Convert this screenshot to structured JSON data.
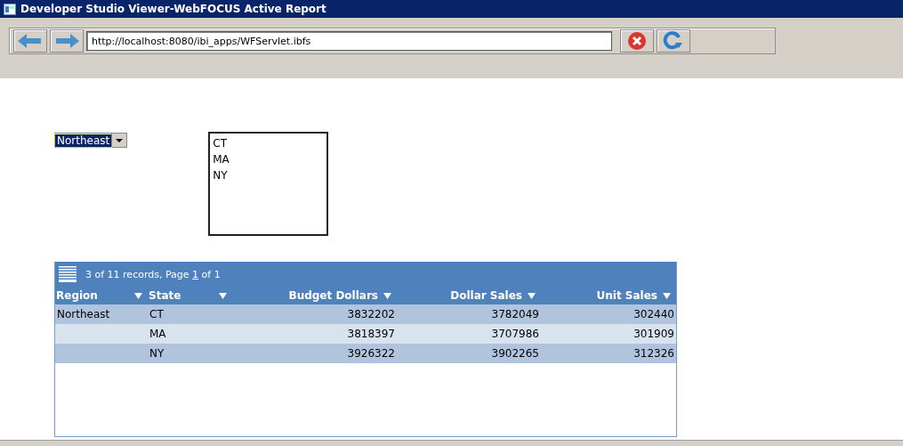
{
  "window": {
    "title": "Developer Studio Viewer-WebFOCUS Active Report"
  },
  "toolbar": {
    "url": "http://localhost:8080/ibi_apps/WFServlet.ibfs"
  },
  "filters": {
    "region_dropdown": {
      "value": "Northeast"
    },
    "state_list": {
      "items": [
        "CT",
        "MA",
        "NY"
      ]
    }
  },
  "report": {
    "status": {
      "records": "3 of 11 records, Page",
      "page": "1",
      "total": "of 1"
    },
    "columns": [
      {
        "label": "Region",
        "kind": "text"
      },
      {
        "label": "State",
        "kind": "text"
      },
      {
        "label": "Budget Dollars",
        "kind": "number"
      },
      {
        "label": "Dollar Sales",
        "kind": "number"
      },
      {
        "label": "Unit Sales",
        "kind": "number"
      }
    ],
    "rows": [
      [
        "Northeast",
        "CT",
        "3832202",
        "3782049",
        "302440"
      ],
      [
        "",
        "MA",
        "3818397",
        "3707986",
        "301909"
      ],
      [
        "",
        "NY",
        "3926322",
        "3902265",
        "312326"
      ]
    ]
  }
}
